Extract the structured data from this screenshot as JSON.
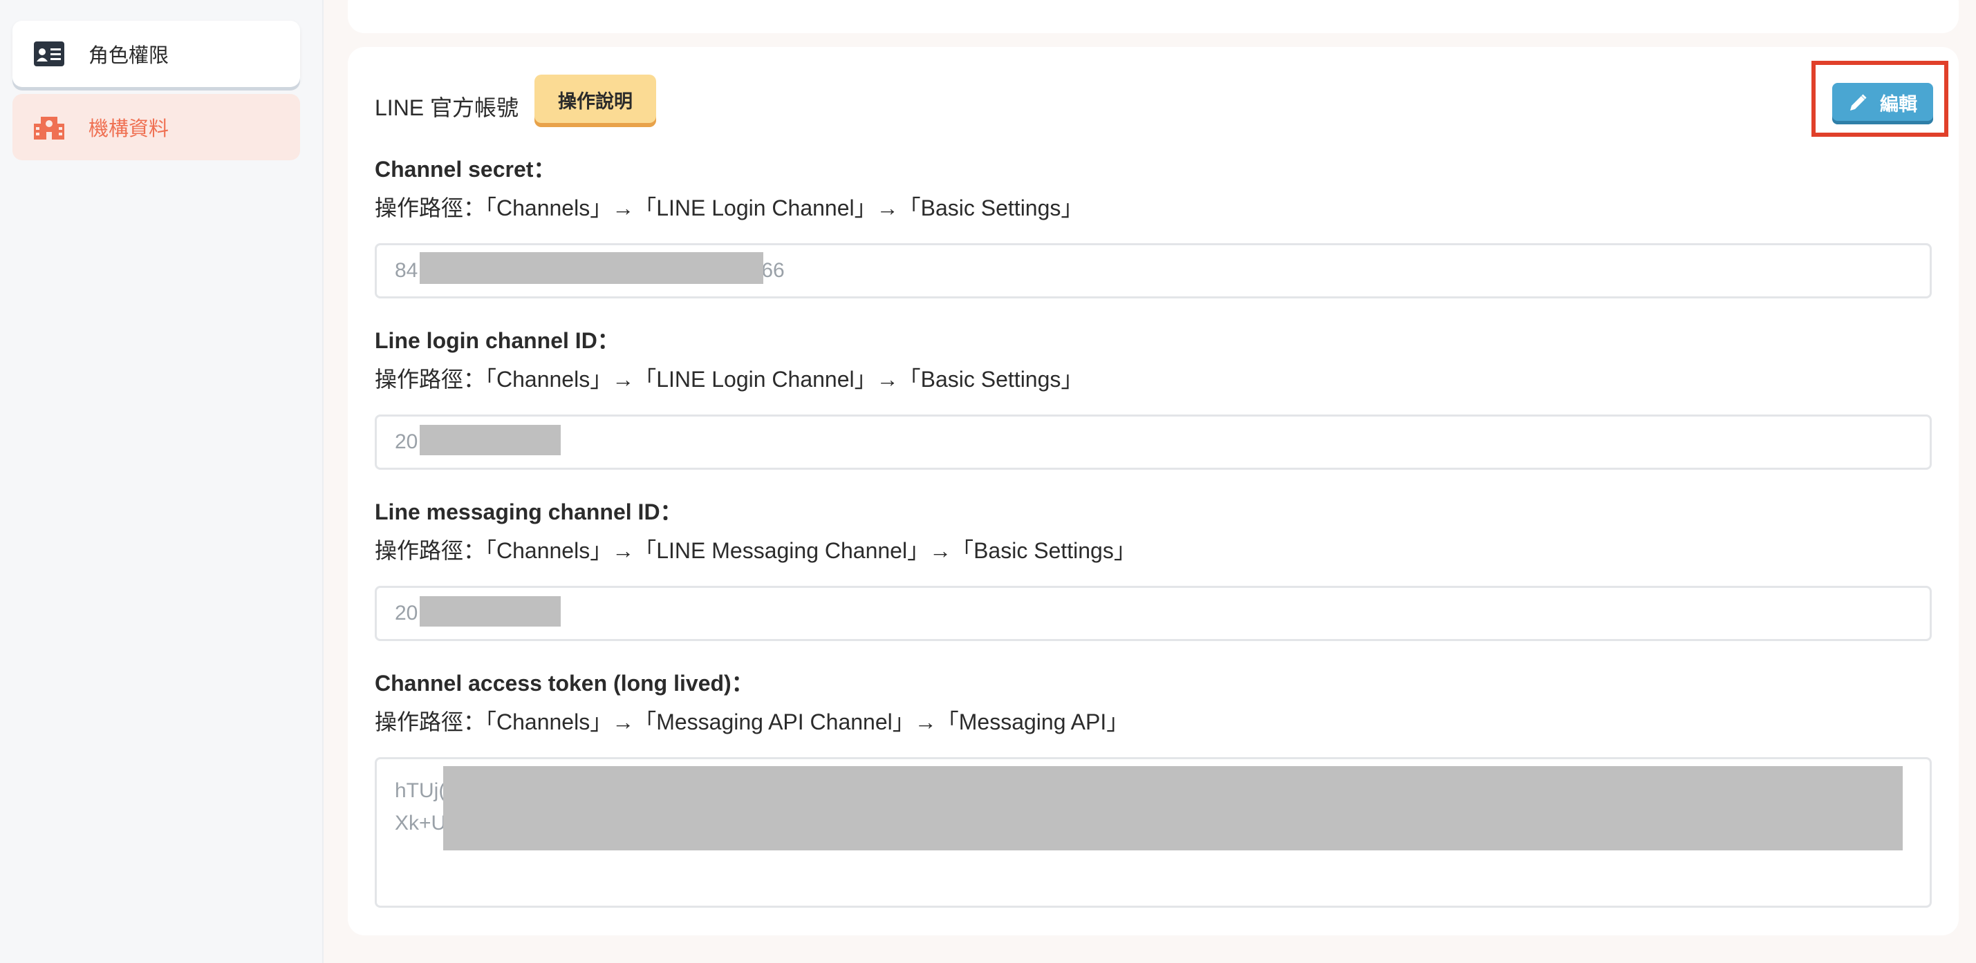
{
  "sidebar": {
    "items": [
      {
        "label": "角色權限",
        "icon": "id-card-icon"
      },
      {
        "label": "機構資料",
        "icon": "building-icon",
        "active": true
      }
    ]
  },
  "card": {
    "title": "LINE 官方帳號",
    "help_label": "操作說明",
    "edit_label": "編輯",
    "fields": [
      {
        "label": "Channel secret：",
        "path": "操作路徑：「Channels」→「LINE Login Channel」→「Basic Settings」",
        "value_prefix": "84",
        "value_suffix": "66"
      },
      {
        "label": "Line login channel ID：",
        "path": "操作路徑：「Channels」→「LINE Login Channel」→「Basic Settings」",
        "value_prefix": "20"
      },
      {
        "label": "Line messaging channel ID：",
        "path": "操作路徑：「Channels」→「LINE Messaging Channel」→「Basic Settings」",
        "value_prefix": "20"
      },
      {
        "label": "Channel access token (long lived)：",
        "path": "操作路徑：「Channels」→「Messaging API Channel」→「Messaging API」",
        "value_line1": "hTUj(",
        "value_line2": "Xk+U"
      }
    ]
  },
  "colors": {
    "accent": "#ef7052",
    "help_button": "#fbdb94",
    "edit_button": "#4aa6d2",
    "highlight_box": "#e0402a"
  }
}
